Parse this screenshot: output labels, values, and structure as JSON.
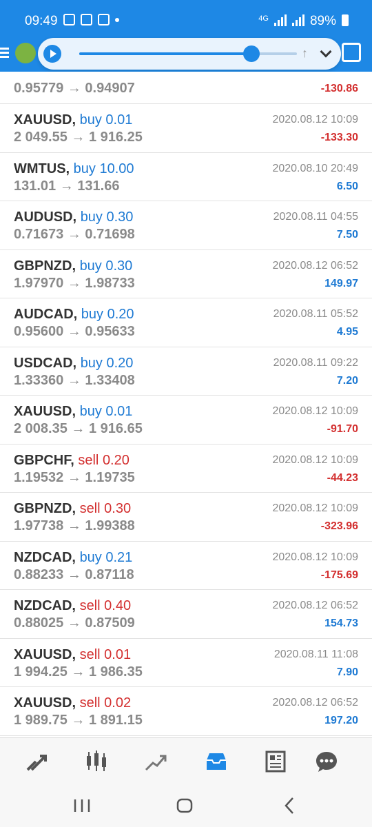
{
  "status_bar": {
    "time": "09:49",
    "network": "4G",
    "battery": "89%"
  },
  "trades": [
    {
      "symbol": "",
      "side": "",
      "volume": "",
      "prices": "0.95779 → 0.94907",
      "datetime": "",
      "profit": "-130.86",
      "profit_sign": "neg",
      "partial": true
    },
    {
      "symbol": "XAUUSD,",
      "side": "buy",
      "volume": "0.01",
      "prices": "2 049.55 → 1 916.25",
      "datetime": "2020.08.12 10:09",
      "profit": "-133.30",
      "profit_sign": "neg"
    },
    {
      "symbol": "WMTUS,",
      "side": "buy",
      "volume": "10.00",
      "prices": "131.01 → 131.66",
      "datetime": "2020.08.10 20:49",
      "profit": "6.50",
      "profit_sign": "pos"
    },
    {
      "symbol": "AUDUSD,",
      "side": "buy",
      "volume": "0.30",
      "prices": "0.71673 → 0.71698",
      "datetime": "2020.08.11 04:55",
      "profit": "7.50",
      "profit_sign": "pos"
    },
    {
      "symbol": "GBPNZD,",
      "side": "buy",
      "volume": "0.30",
      "prices": "1.97970 → 1.98733",
      "datetime": "2020.08.12 06:52",
      "profit": "149.97",
      "profit_sign": "pos"
    },
    {
      "symbol": "AUDCAD,",
      "side": "buy",
      "volume": "0.20",
      "prices": "0.95600 → 0.95633",
      "datetime": "2020.08.11 05:52",
      "profit": "4.95",
      "profit_sign": "pos"
    },
    {
      "symbol": "USDCAD,",
      "side": "buy",
      "volume": "0.20",
      "prices": "1.33360 → 1.33408",
      "datetime": "2020.08.11 09:22",
      "profit": "7.20",
      "profit_sign": "pos"
    },
    {
      "symbol": "XAUUSD,",
      "side": "buy",
      "volume": "0.01",
      "prices": "2 008.35 → 1 916.65",
      "datetime": "2020.08.12 10:09",
      "profit": "-91.70",
      "profit_sign": "neg"
    },
    {
      "symbol": "GBPCHF,",
      "side": "sell",
      "volume": "0.20",
      "prices": "1.19532 → 1.19735",
      "datetime": "2020.08.12 10:09",
      "profit": "-44.23",
      "profit_sign": "neg"
    },
    {
      "symbol": "GBPNZD,",
      "side": "sell",
      "volume": "0.30",
      "prices": "1.97738 → 1.99388",
      "datetime": "2020.08.12 10:09",
      "profit": "-323.96",
      "profit_sign": "neg"
    },
    {
      "symbol": "NZDCAD,",
      "side": "buy",
      "volume": "0.21",
      "prices": "0.88233 → 0.87118",
      "datetime": "2020.08.12 10:09",
      "profit": "-175.69",
      "profit_sign": "neg"
    },
    {
      "symbol": "NZDCAD,",
      "side": "sell",
      "volume": "0.40",
      "prices": "0.88025 → 0.87509",
      "datetime": "2020.08.12 06:52",
      "profit": "154.73",
      "profit_sign": "pos"
    },
    {
      "symbol": "XAUUSD,",
      "side": "sell",
      "volume": "0.01",
      "prices": "1 994.25 → 1 986.35",
      "datetime": "2020.08.11 11:08",
      "profit": "7.90",
      "profit_sign": "pos"
    },
    {
      "symbol": "XAUUSD,",
      "side": "sell",
      "volume": "0.02",
      "prices": "1 989.75 → 1 891.15",
      "datetime": "2020.08.12 06:52",
      "profit": "197.20",
      "profit_sign": "pos"
    }
  ],
  "media": {
    "progress_fraction": 0.79
  },
  "bottom_nav": [
    {
      "icon": "quotes-icon"
    },
    {
      "icon": "chart-icon"
    },
    {
      "icon": "trade-icon"
    },
    {
      "icon": "history-icon",
      "active": true
    },
    {
      "icon": "news-icon"
    },
    {
      "icon": "chat-icon"
    }
  ],
  "colors": {
    "accent": "#1e88e5",
    "buy": "#1e7ad3",
    "sell": "#d32f2f"
  }
}
